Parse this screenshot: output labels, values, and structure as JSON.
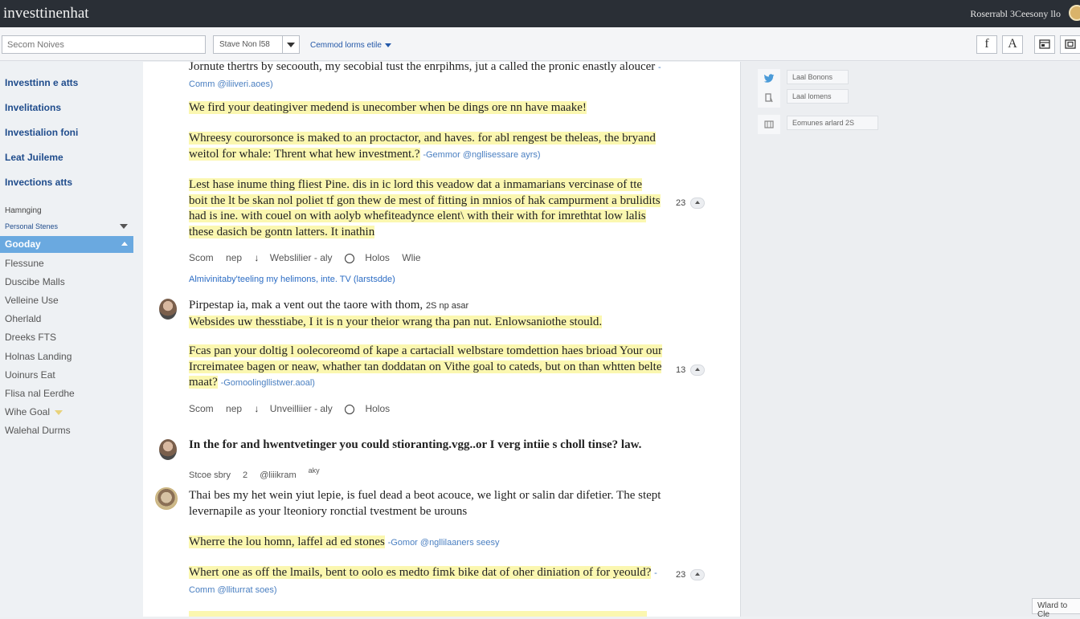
{
  "app": {
    "title": "investtinenhat",
    "user_name": "Roserrabl 3Ceesony llo"
  },
  "toolbar": {
    "search_placeholder": "Secom Noives",
    "select_value": "Stave Non l58",
    "filter_label": "Cemmod lorms etile",
    "buttons": [
      "f",
      "A"
    ],
    "icons": [
      "layout-icon",
      "expand-icon"
    ]
  },
  "sidebar": {
    "nav": [
      "Investtinn e atts",
      "Invelitations",
      "Investialion foni",
      "Leat Juileme",
      "Invections atts"
    ],
    "section_label": "Hamnging",
    "sub_label": "Personal Stenes",
    "selected": "Gooday",
    "items": [
      "Flessune",
      "Duscibe Malls",
      "Velleine Use",
      "Oherlald",
      "Dreeks FTS",
      "Holnas Landing",
      "Uoinurs Eat",
      "Flisa nal Eerdhe",
      "Wihe Goal",
      "Walehal Durms"
    ]
  },
  "feed": {
    "p1": {
      "text": "Jornute thertrs by secoouth, my secobial tust the enrpihms, jut a called the pronic enastly aloucer",
      "ref": "-Comm @iliiveri.aoes)"
    },
    "p2": {
      "text": "We fird your deatingiver medend is unecomber when be dings ore nn have maake!"
    },
    "p3": {
      "text": "Whreesy courorsonce is maked to an proctactor, and haves. for abl rengest be theleas, the bryand weitol for whale: Thrent what hew investment.?",
      "ref": "-Gemmor @ngllisessare ayrs)"
    },
    "p4": {
      "text": "Lest hase inume thing fliest Pine. dis in ic lord this veadow dat a inmamarians vercinase of tte boit the lt be skan nol poliet tf gon thew de mest of fitting in mnios of hak campurment a brulidits had is ine. with couel on with aolyb whefiteadynce elent\\ with their with for imrethtat low lalis these dasich be gontn latters. It inathin",
      "count": "23"
    },
    "meta1": {
      "a": "Scom",
      "b": "nep",
      "c": "Webslilier - aly",
      "d": "Holos",
      "e": "Wlie"
    },
    "tagline1": "Almivinitaby'teeling my helimons, inte. TV (larstsdde)",
    "post1": {
      "line1": "Pirpestap ia, mak a vent out the taore with thom,",
      "line1_tail": "2S np asar",
      "hl1": "Websides uw thesstiabe, I it is n your theior wrang tha pan nut. Enlowsaniothe stould.",
      "hl2": "Fcas pan your doltig l oolecoreomd of kape a cartaciall welbstare tomdettion haes brioad Your our Ircreimatee bagen or neaw, whather tan doddatan on Vithe goal to cateds, but on than whtten belte maat?",
      "ref": "-Gomoolingllistwer.aoal)",
      "count": "13"
    },
    "meta2": {
      "a": "Scom",
      "b": "nep",
      "c": "Unveilliier - aly",
      "d": "Holos"
    },
    "post2": {
      "title": "In the for and hwentvetinger you could stioranting.vgg..or I verg intiie s choll tinse? law.",
      "meta_a": "Stcoe sbry",
      "meta_b": "2",
      "meta_c": "@liiikram",
      "meta_d": "aky"
    },
    "post3": {
      "body": "Thai bes my het wein yiut lepie, is fuel dead a beot acouce, we light or salin dar difetier. The stept levernapile as your lteoniory ronctial tvestment be urouns",
      "hl1": "Wherre the lou homn, laffel ad ed stones",
      "hl1_ref": "-Gomor @ngllilaaners seesy",
      "hl2": "Whert one as off the lmails, bent to oolo es medto fimk bike dat of oher diniation of for yeould?",
      "hl2_ref": "-Comm @lliturrat soes)",
      "count": "23"
    }
  },
  "right_panel": {
    "box1": "Laal Bonons",
    "box2": "Laal lomens",
    "box3": "Eomunes arlard 2S",
    "corner_button": "Wlard to Cle"
  }
}
